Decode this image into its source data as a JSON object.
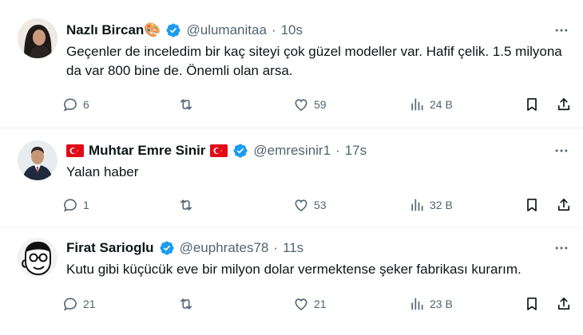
{
  "colors": {
    "text": "#0f1419",
    "muted": "#536471",
    "verified": "#1d9bf0",
    "divider": "#eff3f4"
  },
  "tweets": [
    {
      "name": "Nazlı Bircan",
      "name_emoji": "🎨",
      "handle": "@ulumanitaa",
      "separator": "·",
      "time": "10s",
      "text": "Geçenler de inceledim bir kaç siteyi çok güzel modeller var. Hafif çelik. 1.5 milyona da var 800 bine de. Önemli olan arsa.",
      "replies": "6",
      "retweets": "",
      "likes": "59",
      "views": "24 B"
    },
    {
      "name": "Muhtar Emre Sinir",
      "handle": "@emresinir1",
      "separator": "·",
      "time": "17s",
      "text": "Yalan haber",
      "replies": "1",
      "retweets": "",
      "likes": "53",
      "views": "32 B"
    },
    {
      "name": "Firat Sarioglu",
      "handle": "@euphrates78",
      "separator": "·",
      "time": "11s",
      "text": "Kutu gibi küçücük eve bir milyon dolar vermektense şeker fabrikası kurarım.",
      "replies": "21",
      "retweets": "",
      "likes": "21",
      "views": "23 B"
    }
  ]
}
